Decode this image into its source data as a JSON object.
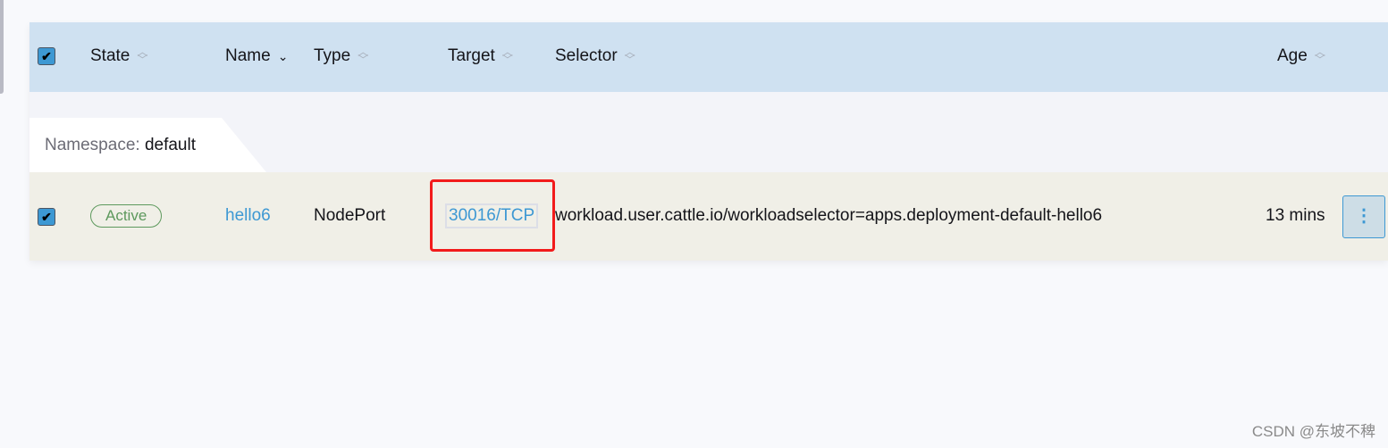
{
  "table": {
    "columns": [
      {
        "label": "State",
        "sort": "none"
      },
      {
        "label": "Name",
        "sort": "desc"
      },
      {
        "label": "Type",
        "sort": "none"
      },
      {
        "label": "Target",
        "sort": "none"
      },
      {
        "label": "Selector",
        "sort": "none"
      },
      {
        "label": "Age",
        "sort": "none"
      }
    ],
    "select_all_checked": true,
    "group": {
      "label": "Namespace:",
      "value": "default"
    },
    "rows": [
      {
        "checked": true,
        "state": "Active",
        "name": "hello6",
        "type": "NodePort",
        "target": "30016/TCP",
        "selector": "workload.user.cattle.io/workloadselector=apps.deployment-default-hello6",
        "age": "13 mins"
      }
    ]
  },
  "highlight_color": "#f21b1b",
  "accent_color": "#3d98d3",
  "watermark": "CSDN @东坡不稗"
}
